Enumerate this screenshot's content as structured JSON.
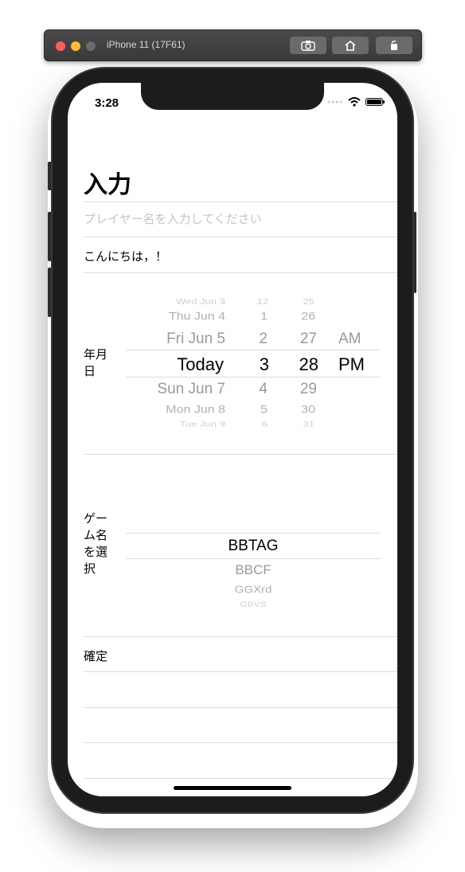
{
  "simulator": {
    "title": "iPhone 11 (17F61)",
    "buttons": [
      "screenshot-icon",
      "home-icon",
      "rotate-icon"
    ]
  },
  "status_bar": {
    "time": "3:28"
  },
  "nav": {
    "title": "入力"
  },
  "form": {
    "player_name_placeholder": "プレイヤー名を入力してください",
    "greeting": "こんにちは，！",
    "date_label": "年月日",
    "game_label": "ゲーム名を選択",
    "confirm_label": "確定"
  },
  "date_picker": {
    "days": [
      "Wed Jun 3",
      "Thu Jun 4",
      "Fri Jun 5",
      "Today",
      "Sun Jun 7",
      "Mon Jun 8",
      "Tue Jun 9"
    ],
    "hours": [
      "12",
      "1",
      "2",
      "3",
      "4",
      "5",
      "6"
    ],
    "minutes": [
      "25",
      "26",
      "27",
      "28",
      "29",
      "30",
      "31"
    ],
    "ampm": [
      "AM",
      "PM"
    ],
    "selected": {
      "day": "Today",
      "hour": "3",
      "minute": "28",
      "ampm": "PM"
    }
  },
  "game_picker": {
    "options": [
      "BBTAG",
      "BBCF",
      "GGXrd",
      "GBVS"
    ],
    "selected": "BBTAG"
  }
}
